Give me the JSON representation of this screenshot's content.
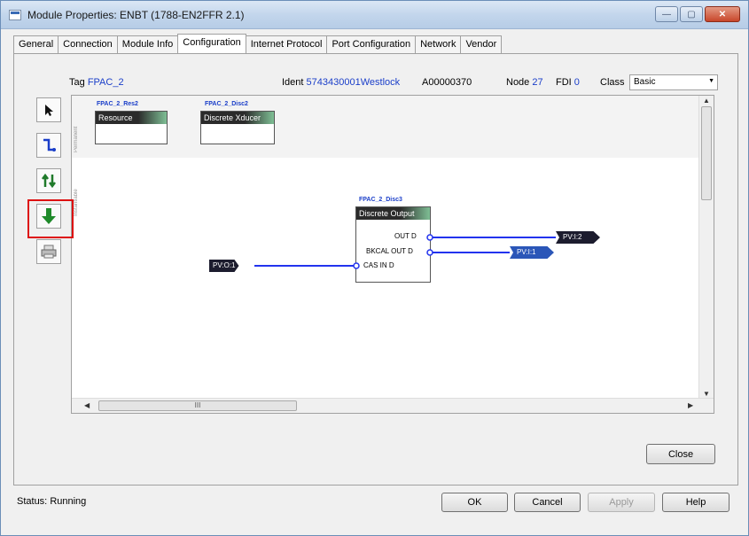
{
  "window": {
    "title": "Module Properties: ENBT (1788-EN2FFR 2.1)",
    "minimize_label": "—",
    "maximize_label": "▢",
    "close_label": "✕"
  },
  "tabs": [
    {
      "label": "General"
    },
    {
      "label": "Connection"
    },
    {
      "label": "Module Info"
    },
    {
      "label": "Configuration"
    },
    {
      "label": "Internet Protocol"
    },
    {
      "label": "Port Configuration"
    },
    {
      "label": "Network"
    },
    {
      "label": "Vendor"
    }
  ],
  "active_tab": "Configuration",
  "header": {
    "tag_label": "Tag",
    "tag_value": "FPAC_2",
    "ident_label": "Ident",
    "ident_value": "5743430001Westlock",
    "ident_code": "A00000370",
    "node_label": "Node",
    "node_value": "27",
    "fdi_label": "FDI",
    "fdi_value": "0",
    "class_label": "Class",
    "class_value": "Basic"
  },
  "toolbar": [
    {
      "icon": "pointer-icon"
    },
    {
      "icon": "link-tool-icon"
    },
    {
      "icon": "sort-icon"
    },
    {
      "icon": "download-arrow-icon"
    },
    {
      "icon": "printer-icon"
    }
  ],
  "canvas": {
    "permanent_label": "Permanent",
    "instantiable_label": "Instantiable",
    "resource_block": {
      "title": "FPAC_2_Res2",
      "head": "Resource"
    },
    "transducer_block": {
      "title": "FPAC_2_Disc2",
      "head": "Discrete Xducer"
    },
    "output_block": {
      "title": "FPAC_2_Disc3",
      "head": "Discrete Output",
      "pins": {
        "out": "OUT D",
        "bkcal": "BKCAL OUT D",
        "cas": "CAS IN D"
      }
    },
    "tags": {
      "pv_o1": "PV:O:1",
      "pv_i2": "PV:I:2",
      "pv_i1": "PV:I:1"
    },
    "link_color": "#2233ee",
    "scroll_grip": "III"
  },
  "buttons": {
    "close": "Close",
    "ok": "OK",
    "cancel": "Cancel",
    "apply": "Apply",
    "help": "Help"
  },
  "status": {
    "label": "Status:",
    "value": "Running"
  }
}
